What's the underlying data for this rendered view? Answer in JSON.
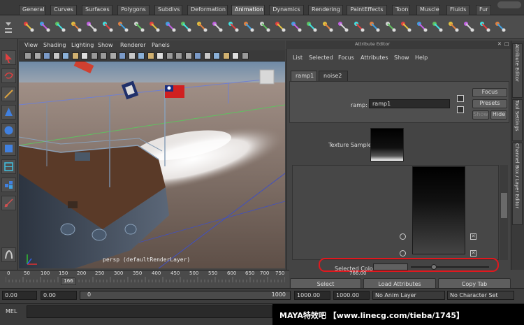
{
  "shelf": {
    "tabs": [
      "General",
      "Curves",
      "Surfaces",
      "Polygons",
      "Subdivs",
      "Deformation",
      "Animation",
      "Dynamics",
      "Rendering",
      "PaintEffects",
      "Toon",
      "Muscle",
      "Fluids",
      "Fur"
    ],
    "active_tab": "Animation"
  },
  "viewport": {
    "menu": [
      "View",
      "Shading",
      "Lighting",
      "Show",
      "Renderer",
      "Panels"
    ],
    "camera_label": "persp (defaultRenderLayer)"
  },
  "attribute_editor": {
    "title": "Attribute Editor",
    "menu": [
      "List",
      "Selected",
      "Focus",
      "Attributes",
      "Show",
      "Help"
    ],
    "tabs": [
      "ramp1",
      "noise2"
    ],
    "active_tab": "ramp1",
    "node_label": "ramp:",
    "node_value": "ramp1",
    "focus_button": "Focus",
    "presets_button": "Presets",
    "show_button": "Show",
    "hide_button": "Hide",
    "texture_sample_label": "Texture Sample",
    "selected_color_label": "Selected Color",
    "select_button": "Select",
    "load_attributes_button": "Load Attributes",
    "copy_tab_button": "Copy Tab"
  },
  "side_tabs": [
    "Attribute Editor",
    "Tool Settings",
    "Channel Box / Layer Editor"
  ],
  "timeline": {
    "ticks": [
      "50",
      "100",
      "150",
      "200",
      "250",
      "300",
      "350",
      "400",
      "450",
      "500",
      "550",
      "600",
      "650",
      "700",
      "750"
    ],
    "first_tick": "0",
    "current_frame": "166",
    "end_frame": "766.00"
  },
  "range": {
    "start": "0.00",
    "playback_start": "0.00",
    "slider_value": "0",
    "slider_end": "1000",
    "playback_end": "1000.00",
    "end": "1000.00",
    "anim_layer": "No Anim Layer",
    "character_set": "No Character Set"
  },
  "command_line": {
    "label": "MEL"
  },
  "watermark": "MAYA特效吧 【www.linecg.com/tieba/1745】",
  "colors": {
    "highlight_ring": "#e0181e",
    "water": "#6b5b52"
  }
}
